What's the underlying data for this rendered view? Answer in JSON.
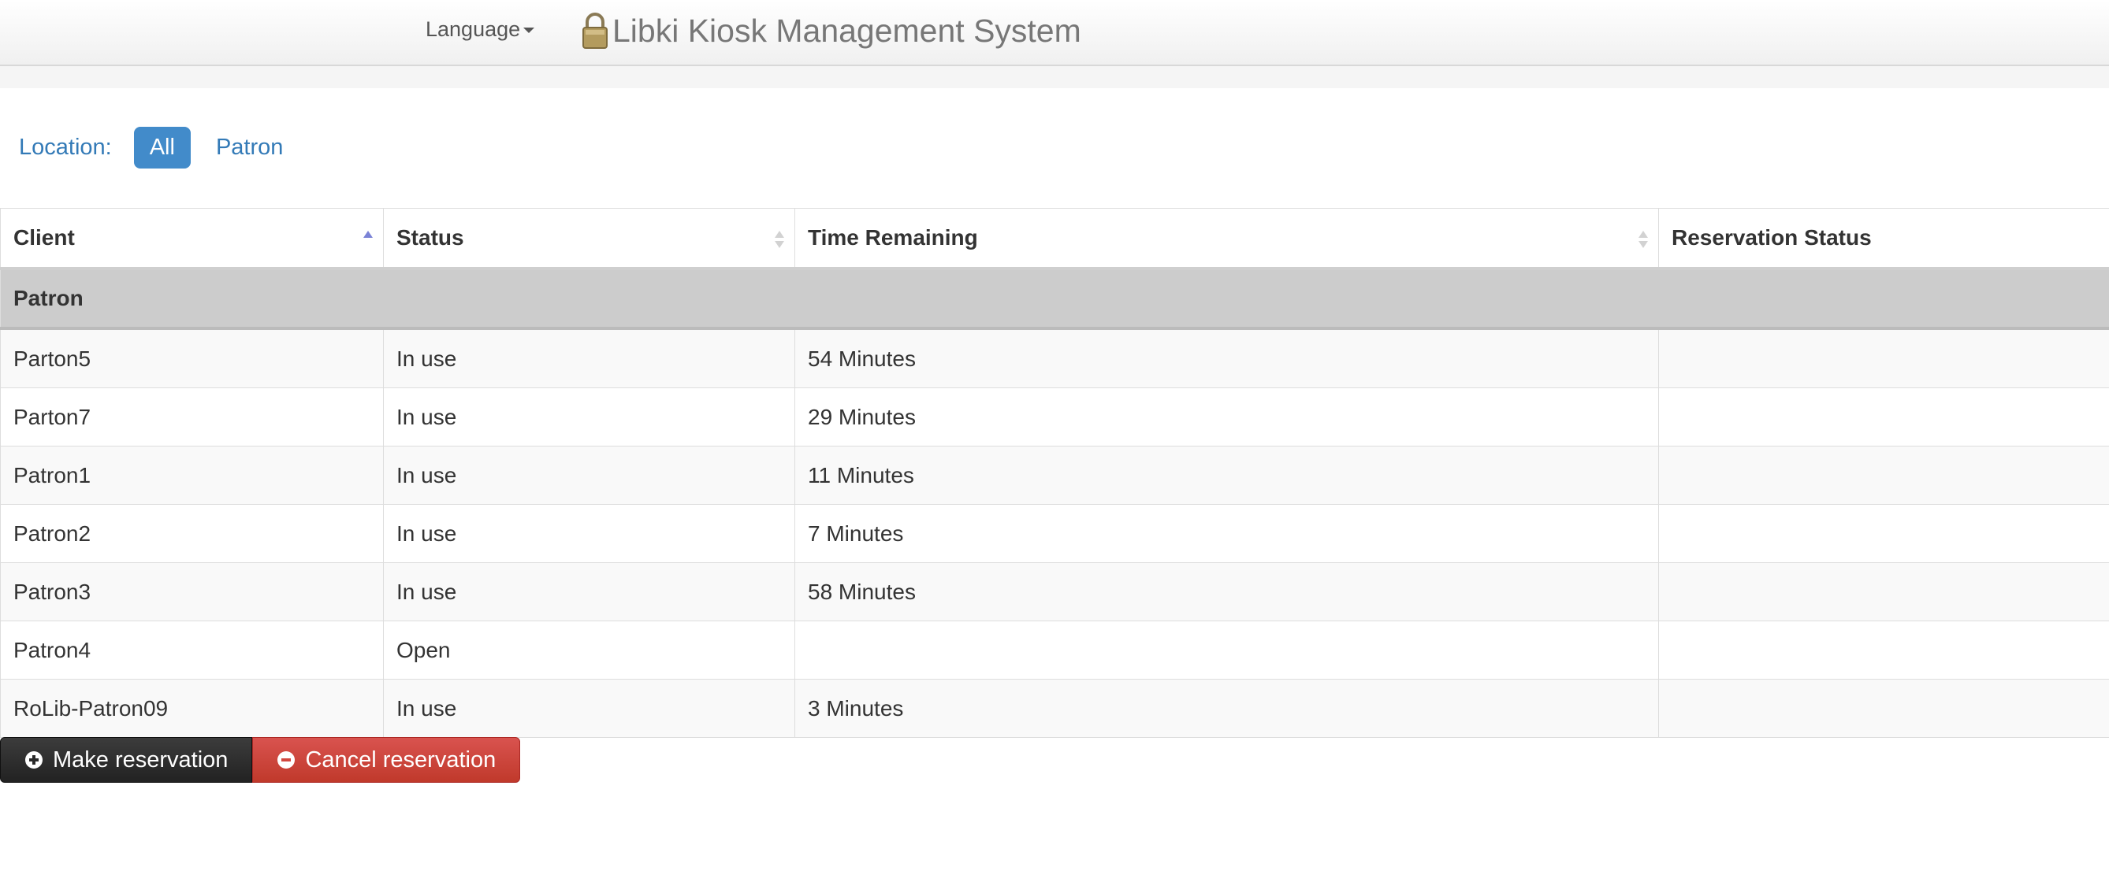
{
  "navbar": {
    "language_label": "Language",
    "brand_title": "Libki Kiosk Management System"
  },
  "location": {
    "label": "Location:",
    "filters": [
      "All",
      "Patron"
    ],
    "selected": "All"
  },
  "table": {
    "headers": {
      "client": "Client",
      "status": "Status",
      "time_remaining": "Time Remaining",
      "reservation_status": "Reservation Status"
    },
    "sorted_column": "Client",
    "sort_direction": "ascending",
    "group_label": "Patron",
    "rows": [
      {
        "client": "Parton5",
        "status": "In use",
        "time_remaining": "54 Minutes",
        "reservation_status": ""
      },
      {
        "client": "Parton7",
        "status": "In use",
        "time_remaining": "29 Minutes",
        "reservation_status": ""
      },
      {
        "client": "Patron1",
        "status": "In use",
        "time_remaining": "11 Minutes",
        "reservation_status": ""
      },
      {
        "client": "Patron2",
        "status": "In use",
        "time_remaining": "7 Minutes",
        "reservation_status": ""
      },
      {
        "client": "Patron3",
        "status": "In use",
        "time_remaining": "58 Minutes",
        "reservation_status": ""
      },
      {
        "client": "Patron4",
        "status": "Open",
        "time_remaining": "",
        "reservation_status": ""
      },
      {
        "client": "RoLib-Patron09",
        "status": "In use",
        "time_remaining": "3 Minutes",
        "reservation_status": ""
      }
    ]
  },
  "actions": {
    "make_reservation": "Make reservation",
    "cancel_reservation": "Cancel reservation"
  },
  "icons": {
    "brand": "lock-icon",
    "make": "plus-circle-icon",
    "cancel": "minus-circle-icon"
  },
  "colors": {
    "link_blue": "#337ab7",
    "active_pill": "#428bca",
    "group_row": "#cccccc",
    "btn_dark": "#222222",
    "btn_red": "#d9534f",
    "sort_active": "#7b83d6"
  }
}
